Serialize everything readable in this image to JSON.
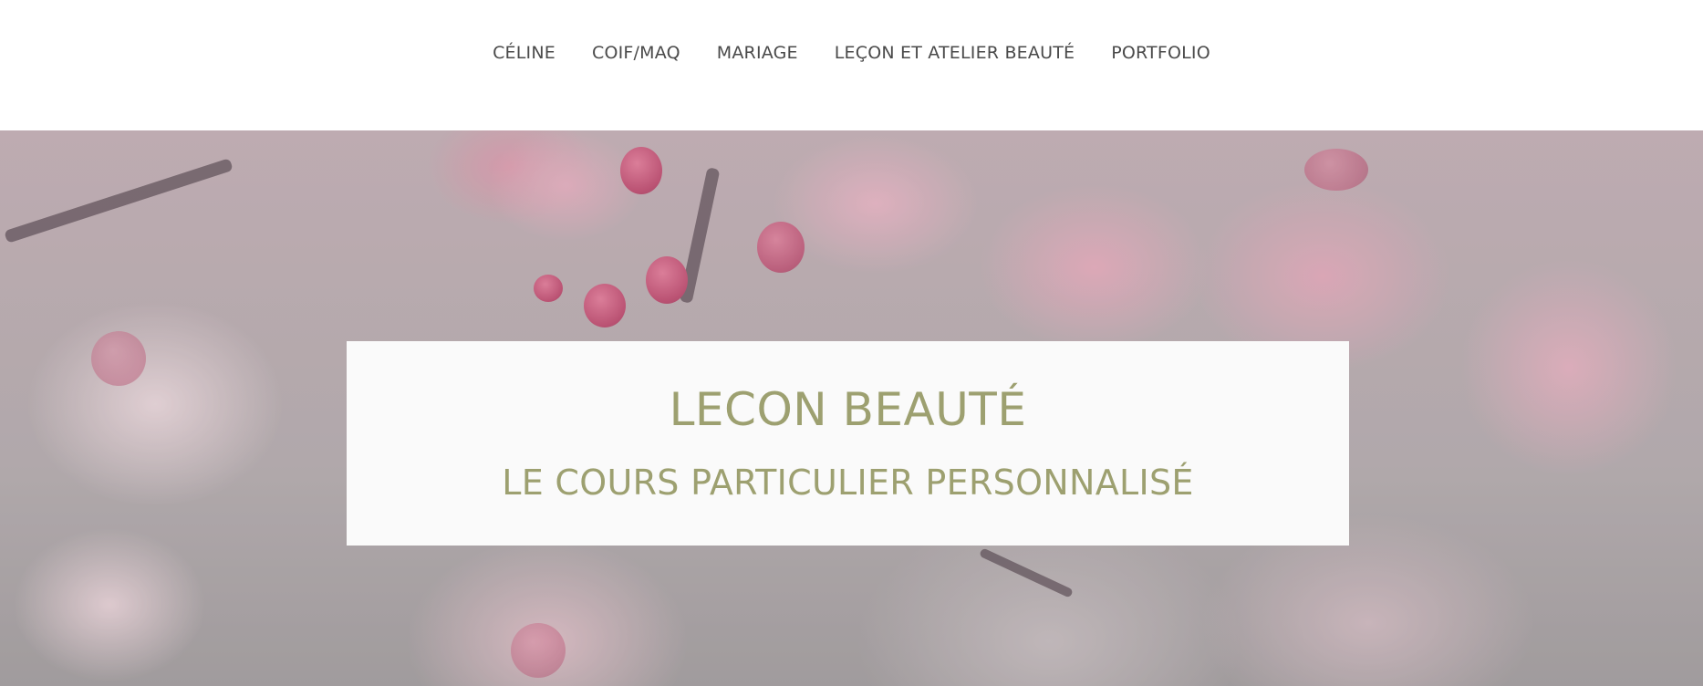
{
  "nav": {
    "items": [
      {
        "label": "CÉLINE"
      },
      {
        "label": "COIF/MAQ"
      },
      {
        "label": "MARIAGE"
      },
      {
        "label": "LEÇON ET ATELIER BEAUTÉ"
      },
      {
        "label": "PORTFOLIO"
      }
    ]
  },
  "hero": {
    "image": "cherry-blossom-photo",
    "title": "LECON BEAUTÉ",
    "subtitle": "LE COURS PARTICULIER PERSONNALISÉ"
  },
  "colors": {
    "nav_text": "#4a4a4a",
    "title_text": "#9da070",
    "card_background": "#fafafa"
  }
}
